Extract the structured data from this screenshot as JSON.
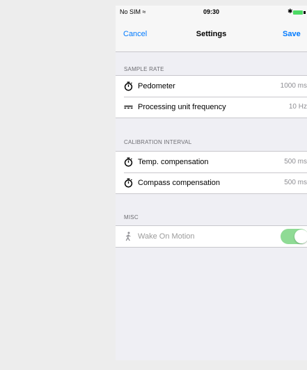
{
  "status_bar": {
    "carrier": "No SIM ≈",
    "time": "09:30",
    "bluetooth": "✱",
    "battery_color": "#4cd964"
  },
  "nav": {
    "cancel_label": "Cancel",
    "title": "Settings",
    "save_label": "Save",
    "accent_color": "#007aff"
  },
  "sections": {
    "sample_rate": {
      "header": "SAMPLE RATE",
      "rows": [
        {
          "label": "Pedometer",
          "value": "1000 ms",
          "icon": "stopwatch-icon"
        },
        {
          "label": "Processing unit frequency",
          "value": "10 Hz",
          "icon": "frequency-icon"
        }
      ]
    },
    "calibration": {
      "header": "CALIBRATION INTERVAL",
      "rows": [
        {
          "label": "Temp. compensation",
          "value": "500 ms",
          "icon": "stopwatch-icon"
        },
        {
          "label": "Compass compensation",
          "value": "500 ms",
          "icon": "stopwatch-icon"
        }
      ]
    },
    "misc": {
      "header": "MISC",
      "rows": [
        {
          "label": "Wake On Motion",
          "icon": "walking-icon",
          "toggle_on": true,
          "enabled": false
        }
      ]
    }
  }
}
